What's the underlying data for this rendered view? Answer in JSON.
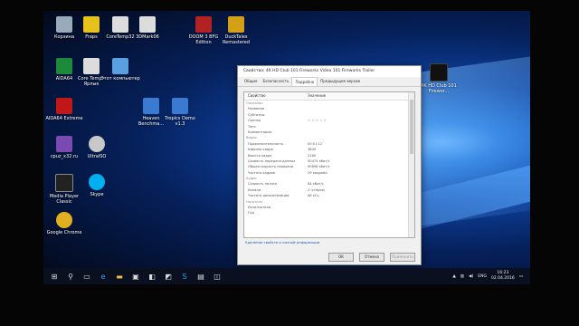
{
  "desktop": {
    "icons": [
      {
        "label": "Корзина",
        "color": "#9ab"
      },
      {
        "label": "Fraps",
        "color": "#e8c21c"
      },
      {
        "label": "CoreTemp32",
        "color": "#dcdcdc"
      },
      {
        "label": "3DMark06",
        "color": "#dcdcdc"
      },
      {
        "label": "DOOM 3 BFG Edition",
        "color": "#b22222"
      },
      {
        "label": "DuckTales Remastered",
        "color": "#d4a017"
      },
      {
        "label": "AIDA64",
        "color": "#1c8a3a"
      },
      {
        "label": "Core Temp - Ярлык",
        "color": "#dcdcdc"
      },
      {
        "label": "Этот компьютер",
        "color": "#5aa0e0"
      },
      {
        "label": "AIDA64 Extreme",
        "color": "#c01818"
      },
      {
        "label": "Heaven Benchma...",
        "color": "#3a7ad0"
      },
      {
        "label": "Tropics Demo v1.3",
        "color": "#3a7ad0"
      },
      {
        "label": "cpuz_x32.ru",
        "color": "#7a4ab0"
      },
      {
        "label": "UltraISO",
        "color": "#c8c8c8"
      },
      {
        "label": "Media Player Classic",
        "color": "#222"
      },
      {
        "label": "Skype",
        "color": "#00aff0"
      },
      {
        "label": "Google Chrome",
        "color": "#e0b020"
      },
      {
        "label": "4K HD Club 101 Firewor...",
        "color": "#111"
      }
    ]
  },
  "window": {
    "title": "Свойства: 4K HD Club 101 Fireworks Video 101 Fireworks Trailer",
    "tabs": [
      "Общие",
      "Безопасность",
      "Подробно",
      "Предыдущие версии"
    ],
    "active_tab": 2,
    "columns": [
      "Свойство",
      "Значение"
    ],
    "rows": [
      {
        "p": "Описание",
        "v": "",
        "group": true
      },
      {
        "p": "Название",
        "v": ""
      },
      {
        "p": "Субтитры",
        "v": ""
      },
      {
        "p": "Оценка",
        "v": "☆ ☆ ☆ ☆ ☆"
      },
      {
        "p": "Теги",
        "v": ""
      },
      {
        "p": "Комментарии",
        "v": ""
      },
      {
        "p": "Видео",
        "v": "",
        "group": true
      },
      {
        "p": "Продолжительность",
        "v": "00:01:12"
      },
      {
        "p": "Ширина кадра",
        "v": "3840"
      },
      {
        "p": "Высота кадра",
        "v": "2160"
      },
      {
        "p": "Скорость передачи данных",
        "v": "90474 кбит/с"
      },
      {
        "p": "Общая скорость передачи",
        "v": "90698 кбит/с"
      },
      {
        "p": "Частота кадров",
        "v": "29 кадров/с"
      },
      {
        "p": "Аудио",
        "v": "",
        "group": true
      },
      {
        "p": "Скорость потока",
        "v": "64 кбит/с"
      },
      {
        "p": "Каналы",
        "v": "2 (стерео)"
      },
      {
        "p": "Частота дискретизации",
        "v": "48 кГц"
      },
      {
        "p": "Носитель",
        "v": "",
        "group": true
      },
      {
        "p": "Исполнители",
        "v": ""
      },
      {
        "p": "Год",
        "v": ""
      }
    ],
    "link": "Удаление свойств и личной информации",
    "buttons": {
      "ok": "ОК",
      "cancel": "Отмена",
      "apply": "Применить"
    }
  },
  "taskbar": {
    "lang": "ENG",
    "time": "16:23",
    "date": "02.04.2016",
    "accent": "#0b1020"
  }
}
